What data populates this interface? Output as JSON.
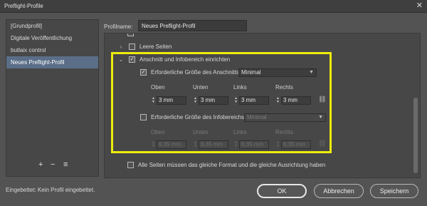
{
  "window": {
    "title": "Preflight-Profile",
    "close_glyph": "✕"
  },
  "sidebar": {
    "items": [
      {
        "label": "[Grundprofil]",
        "selected": false
      },
      {
        "label": "Digitale Veröffentlichung",
        "selected": false
      },
      {
        "label": "butlaix control",
        "selected": false
      },
      {
        "label": "Neues Preflight-Profil",
        "selected": true
      }
    ],
    "add_glyph": "+",
    "remove_glyph": "−",
    "menu_glyph": "≡"
  },
  "status": {
    "embedded": "Eingebettet:  Kein Profil eingebettet."
  },
  "profile": {
    "label": "Profilname:",
    "value": "Neues Preflight-Profil"
  },
  "tree": {
    "leere_seiten": "Leere Seiten",
    "anschnitt_group": "Anschnitt und Infobereich einrichten",
    "anschnitt_required": "Erforderliche Größe des Anschnitts:",
    "anschnitt_mode": "Minimal",
    "info_required": "Erforderliche Größe des Infobereichs:",
    "info_mode": "Minimal",
    "alle_seiten": "Alle Seiten müssen das gleiche Format und die gleiche Ausrichtung haben",
    "columns": [
      "Oben",
      "Unten",
      "Links",
      "Rechts"
    ],
    "anschnitt_values": [
      "3 mm",
      "3 mm",
      "3 mm",
      "3 mm"
    ],
    "info_values": [
      "6,35 mm",
      "6,35 mm",
      "6,35 mm",
      "6,35 mm"
    ],
    "check_glyph": "✓",
    "chevron_right": "›",
    "chevron_down": "⌄",
    "spin_up": "▲",
    "spin_down": "▼",
    "select_arrow": "▼",
    "link_icon": "chain-link-icon",
    "link_glyph": "⛓"
  },
  "buttons": {
    "ok": "OK",
    "cancel": "Abbrechen",
    "save": "Speichern"
  },
  "colors": {
    "highlight": "#ecec0c",
    "selected": "#5a6e88",
    "background": "#535353"
  }
}
